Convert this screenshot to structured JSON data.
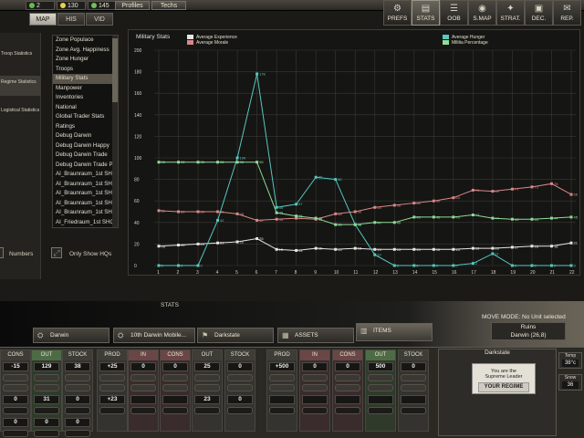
{
  "topbar": {
    "resources": [
      {
        "value": "2",
        "color": "#5fbf4a"
      },
      {
        "value": "130",
        "color": "#e8d24a"
      },
      {
        "value": "145",
        "color": "#6fbf5a"
      }
    ],
    "buttons": [
      "Profiles",
      "Techs"
    ]
  },
  "tabs": [
    "MAP",
    "HIS",
    "VID"
  ],
  "toolbar": [
    {
      "label": "PREFS",
      "icon": "prefs-icon"
    },
    {
      "label": "STATS",
      "icon": "stats-icon"
    },
    {
      "label": "OOB",
      "icon": "oob-icon"
    },
    {
      "label": "S.MAP",
      "icon": "strategic-map-icon"
    },
    {
      "label": "STRAT.",
      "icon": "strategy-icon"
    },
    {
      "label": "DEC.",
      "icon": "decisions-icon"
    },
    {
      "label": "REP.",
      "icon": "reports-icon"
    }
  ],
  "leftpanel": [
    "Troop Statistics",
    "Regime Statistics",
    "Logistical Statistics"
  ],
  "stat_list": [
    "Zone Populace",
    "Zone Avg. Happiness",
    "Zone Hunger",
    "Troops",
    "Military Stats",
    "Manpower",
    "Inventories",
    "National",
    "Global Trader Stats",
    "Ratings",
    "Debug Darwin",
    "Debug Darwin Happy",
    "Debug Darwin Trade",
    "Debug Darwin Trade Pr",
    "AI_Braunraum_1st SHQ",
    "AI_Braunraum_1st SHQ",
    "AI_Braunraum_1st SHQ",
    "AI_Braunraum_1st SHQ",
    "AI_Braunraum_1st SHQ",
    "AI_Friedraum_1st SHQ"
  ],
  "stat_list_selected": 4,
  "options": {
    "numbers_label": "Numbers",
    "only_hqs_label": "Only Show HQs"
  },
  "chart_data": {
    "type": "line",
    "title": "Military Stats",
    "ylim": [
      0,
      200
    ],
    "yticks": [
      0,
      20,
      40,
      60,
      80,
      100,
      120,
      140,
      160,
      180,
      200
    ],
    "x": [
      1,
      2,
      3,
      4,
      5,
      6,
      7,
      8,
      9,
      10,
      11,
      12,
      13,
      14,
      15,
      16,
      17,
      18,
      19,
      20,
      21,
      22
    ],
    "grid": true,
    "series": [
      {
        "name": "Average Experience",
        "color": "#e6e6e6",
        "values": [
          18,
          19,
          20,
          21,
          22,
          25,
          15,
          14,
          16,
          15,
          16,
          15,
          15,
          15,
          15,
          15,
          16,
          16,
          17,
          18,
          18,
          21
        ]
      },
      {
        "name": "Average Morale",
        "color": "#d88888",
        "values": [
          51,
          50,
          50,
          50,
          48,
          42,
          43,
          44,
          43,
          48,
          50,
          54,
          56,
          58,
          60,
          63,
          70,
          69,
          71,
          73,
          76,
          66
        ]
      },
      {
        "name": "Average Hunger",
        "color": "#55c8c0",
        "values": [
          0,
          0,
          0,
          42,
          100,
          178,
          54,
          57,
          82,
          80,
          38,
          10,
          0,
          0,
          0,
          0,
          2,
          11,
          0,
          0,
          0,
          0
        ]
      },
      {
        "name": "Militia Percentage",
        "color": "#8fdc9a",
        "values": [
          96,
          96,
          96,
          96,
          96,
          96,
          49,
          46,
          44,
          38,
          38,
          40,
          40,
          45,
          45,
          45,
          47,
          44,
          43,
          43,
          44,
          45
        ]
      }
    ]
  },
  "stats_label": "STATS",
  "bottom_tabs": [
    {
      "label": "Darwin",
      "icon": "unit-icon"
    },
    {
      "label": "10th Darwin Mobile...",
      "icon": "division-icon"
    },
    {
      "label": "Darkstate",
      "icon": "flag-icon"
    },
    {
      "label": "ASSETS",
      "icon": "assets-icon"
    },
    {
      "label": "ITEMS",
      "icon": "items-icon"
    }
  ],
  "move_mode": "MOVE MODE: No Unit selected",
  "hex_info": {
    "terrain": "Ruins",
    "location": "Darwin (26,8)"
  },
  "production": [
    {
      "hd": "CONS",
      "val": "-15",
      "style": "grey",
      "rows": [
        "0",
        "0"
      ]
    },
    {
      "hd": "OUT",
      "val": "129",
      "style": "green",
      "rows": [
        "31",
        "0"
      ]
    },
    {
      "hd": "STOCK",
      "val": "38",
      "style": "grey",
      "rows": [
        "0",
        "0"
      ]
    },
    {
      "hd": "PROD",
      "val": "+25",
      "style": "grey",
      "rows": [
        "+23"
      ]
    },
    {
      "hd": "IN",
      "val": "0",
      "style": "red",
      "rows": [
        ""
      ]
    },
    {
      "hd": "CONS",
      "val": "0",
      "style": "red",
      "rows": [
        ""
      ]
    },
    {
      "hd": "OUT",
      "val": "25",
      "style": "grey",
      "rows": [
        "23"
      ]
    },
    {
      "hd": "STOCK",
      "val": "0",
      "style": "grey",
      "rows": [
        "0"
      ]
    },
    {
      "hd": "PROD",
      "val": "+500",
      "style": "grey",
      "rows": [
        ""
      ]
    },
    {
      "hd": "IN",
      "val": "0",
      "style": "red",
      "rows": [
        ""
      ]
    },
    {
      "hd": "CONS",
      "val": "0",
      "style": "red",
      "rows": [
        ""
      ]
    },
    {
      "hd": "OUT",
      "val": "500",
      "style": "green",
      "rows": [
        ""
      ]
    },
    {
      "hd": "STOCK",
      "val": "0",
      "style": "grey",
      "rows": [
        ""
      ]
    }
  ],
  "regime": {
    "name": "Darkstate",
    "line1": "You are the",
    "line2": "Supreme Leader",
    "badge": "YOUR REGIME"
  },
  "weather": {
    "temp_label": "Temp",
    "temp": "38°c",
    "snow_label": "Snow",
    "snow": "36"
  }
}
